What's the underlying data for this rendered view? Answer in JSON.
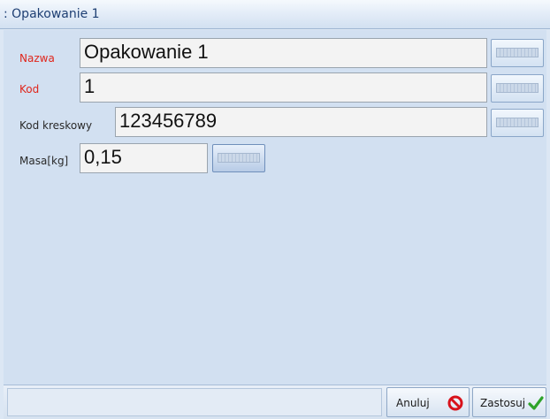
{
  "window": {
    "title": ": Opakowanie 1"
  },
  "form": {
    "name": {
      "label": "Nazwa",
      "value": "Opakowanie 1",
      "required": true
    },
    "code": {
      "label": "Kod",
      "value": "1",
      "required": true
    },
    "barcode": {
      "label": "Kod kreskowy",
      "value": "123456789",
      "required": false
    },
    "mass": {
      "label": "Masa[kg]",
      "value": "0,15",
      "required": false
    }
  },
  "footer": {
    "cancel_label": "Anuluj",
    "apply_label": "Zastosuj"
  },
  "colors": {
    "required_label": "#e0261c",
    "cancel_icon": "#d8121b",
    "apply_icon": "#2ea32a"
  },
  "icons": [
    "keyboard-icon",
    "cancel-icon",
    "checkmark-icon"
  ]
}
